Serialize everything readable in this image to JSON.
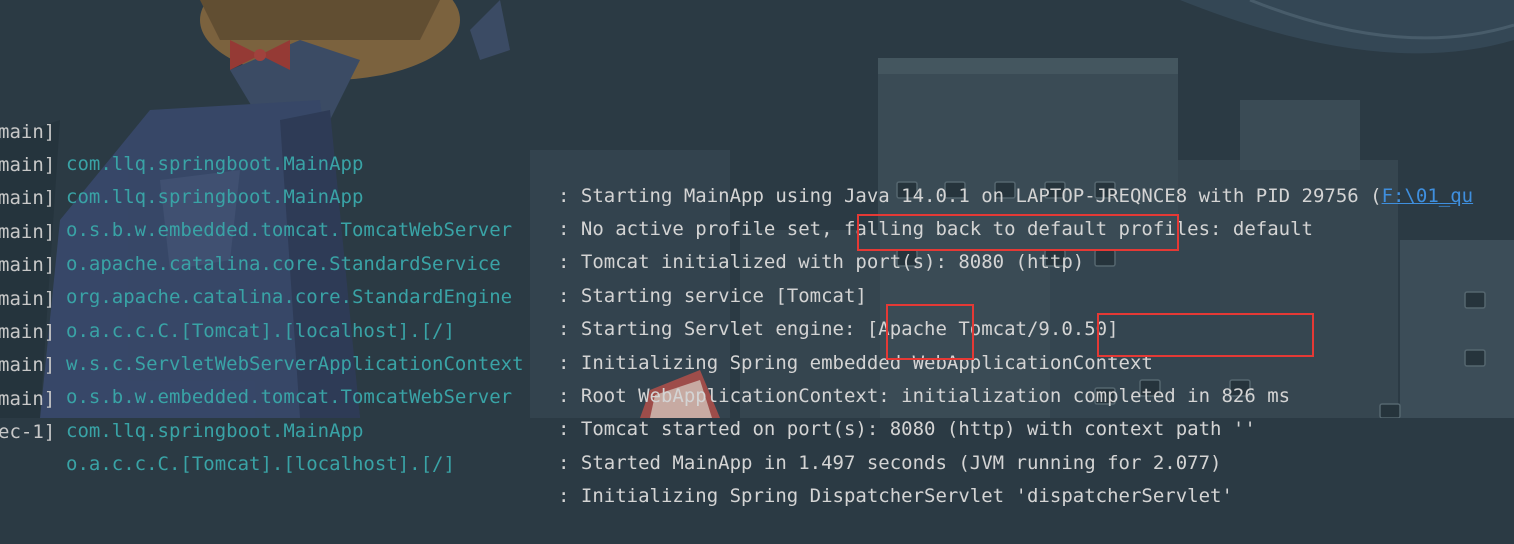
{
  "colors": {
    "background": "#2b3a44",
    "thread_text": "#c8c8c8",
    "logger_text": "#39a3a6",
    "message_text": "#d4d4d4",
    "link_text": "#3f8fde",
    "highlight_border": "#e53935"
  },
  "log_lines": [
    {
      "thread": "main]",
      "logger": "com.llq.springboot.MainApp",
      "message": ": Starting MainApp using Java 14.0.1 on LAPTOP-JREQNCE8 with PID 29756 (",
      "link": "F:\\01_qu"
    },
    {
      "thread": "main]",
      "logger": "com.llq.springboot.MainApp",
      "message": ": No active profile set, falling back to default profiles: default"
    },
    {
      "thread": "main]",
      "logger": "o.s.b.w.embedded.tomcat.TomcatWebServer",
      "message": ": Tomcat initialized with port(s): 8080 (http)"
    },
    {
      "thread": "main]",
      "logger": "o.apache.catalina.core.StandardService",
      "message": ": Starting service [Tomcat]"
    },
    {
      "thread": "main]",
      "logger": "org.apache.catalina.core.StandardEngine",
      "message": ": Starting Servlet engine: [Apache Tomcat/9.0.50]"
    },
    {
      "thread": "main]",
      "logger": "o.a.c.c.C.[Tomcat].[localhost].[/]",
      "message": ": Initializing Spring embedded WebApplicationContext"
    },
    {
      "thread": "main]",
      "logger": "w.s.c.ServletWebServerApplicationContext",
      "message": ": Root WebApplicationContext: initialization completed in 826 ms"
    },
    {
      "thread": "main]",
      "logger": "o.s.b.w.embedded.tomcat.TomcatWebServer",
      "message": ": Tomcat started on port(s): 8080 (http) with context path ''"
    },
    {
      "thread": "main]",
      "logger": "com.llq.springboot.MainApp",
      "message": ": Started MainApp in 1.497 seconds (JVM running for 2.077)"
    },
    {
      "thread": "ec-1]",
      "logger": "o.a.c.c.C.[Tomcat].[localhost].[/]",
      "message": ": Initializing Spring DispatcherServlet 'dispatcherServlet'"
    }
  ]
}
